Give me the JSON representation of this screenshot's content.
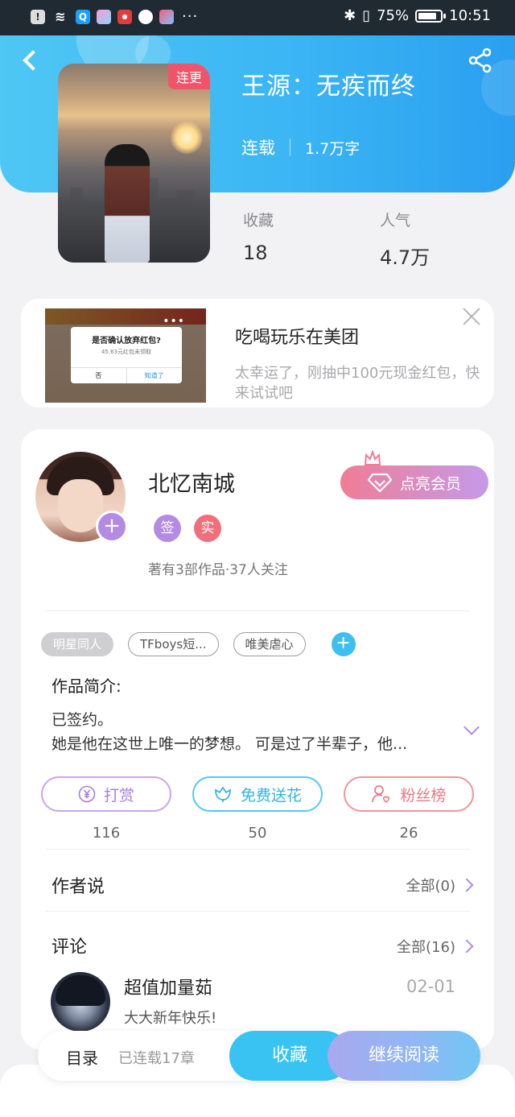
{
  "status_bar": {
    "icons": [
      "alert-icon",
      "wifi-icon",
      "search-app-icon",
      "app-icon",
      "news-app-icon",
      "browser-app-icon",
      "store-app-icon"
    ],
    "more": "···",
    "battery_pct": "75%",
    "time": "10:51"
  },
  "header": {
    "title": "王源：无疾而终",
    "serial_status": "连载",
    "word_count": "1.7万字",
    "cover_badge": "连更",
    "stats": [
      {
        "label": "收藏",
        "value": "18"
      },
      {
        "label": "人气",
        "value": "4.7万"
      }
    ],
    "colors": {
      "gradient_start": "#4fc7f4",
      "gradient_end": "#2a9ff0"
    }
  },
  "ad": {
    "title": "吃喝玩乐在美团",
    "description": "太幸运了，刚抽中100元现金红包，快来试试吧",
    "dialog_title": "是否确认放弃红包?",
    "dialog_sub": "45.63元红包未领取",
    "dialog_no": "否",
    "dialog_yes": "知道了"
  },
  "author": {
    "name": "北忆南城",
    "badge_sign": "签",
    "badge_real": "实",
    "meta": "著有3部作品·37人关注",
    "vip_button": "点亮会员"
  },
  "tags": [
    "明星同人",
    "TFboys短...",
    "唯美虐心"
  ],
  "intro": {
    "label": "作品简介:",
    "text": "已签约。\n她是他在这世上唯一的梦想。 可是过了半辈子，他..."
  },
  "actions": [
    {
      "label": "打赏",
      "count": "116",
      "icon": "yuan-coin-icon"
    },
    {
      "label": "免费送花",
      "count": "50",
      "icon": "flower-icon"
    },
    {
      "label": "粉丝榜",
      "count": "26",
      "icon": "fan-user-icon"
    }
  ],
  "author_says": {
    "title": "作者说",
    "link": "全部(0)"
  },
  "comments": {
    "title": "评论",
    "link": "全部(16)",
    "items": [
      {
        "user": "超值加量茹",
        "date": "02-01",
        "text": "大大新年快乐!"
      }
    ]
  },
  "bottom_bar": {
    "toc": "目录",
    "chapters": "已连载17章",
    "collect": "收藏",
    "continue": "继续阅读"
  }
}
